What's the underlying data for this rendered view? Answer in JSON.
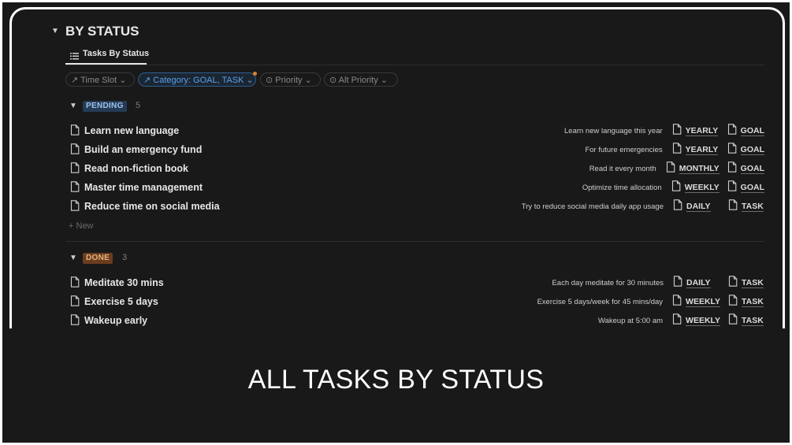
{
  "section": {
    "title": "BY STATUS"
  },
  "view_tab": {
    "label": "Tasks By Status"
  },
  "filters": [
    {
      "label": "Time Slot",
      "active": false
    },
    {
      "label": "Category: GOAL, TASK",
      "active": true
    },
    {
      "label": "Priority",
      "active": false
    },
    {
      "label": "Alt Priority",
      "active": false
    }
  ],
  "groups": [
    {
      "status": "PENDING",
      "count": "5",
      "rows": [
        {
          "title": "Learn new language",
          "desc": "Learn new language this year",
          "period": "YEARLY",
          "category": "GOAL"
        },
        {
          "title": "Build an emergency fund",
          "desc": "For future emergencies",
          "period": "YEARLY",
          "category": "GOAL"
        },
        {
          "title": "Read non-fiction book",
          "desc": "Read it every month",
          "period": "MONTHLY",
          "category": "GOAL"
        },
        {
          "title": "Master time management",
          "desc": "Optimize time allocation",
          "period": "WEEKLY",
          "category": "GOAL"
        },
        {
          "title": "Reduce time on social media",
          "desc": "Try to reduce social media daily app usage",
          "period": "DAILY",
          "category": "TASK"
        }
      ],
      "new_label": "New"
    },
    {
      "status": "DONE",
      "count": "3",
      "rows": [
        {
          "title": "Meditate 30 mins",
          "desc": "Each day meditate for 30 minutes",
          "period": "DAILY",
          "category": "TASK"
        },
        {
          "title": "Exercise 5 days",
          "desc": "Exercise 5 days/week for 45 mins/day",
          "period": "WEEKLY",
          "category": "TASK"
        },
        {
          "title": "Wakeup early",
          "desc": "Wakeup at 5:00 am",
          "period": "WEEKLY",
          "category": "TASK"
        }
      ]
    }
  ],
  "caption": "ALL TASKS BY STATUS",
  "colors": {
    "background": "#191919",
    "pending_badge": "#253b55",
    "done_badge": "#6a3d1f",
    "active_filter": "#5aa0e6"
  }
}
